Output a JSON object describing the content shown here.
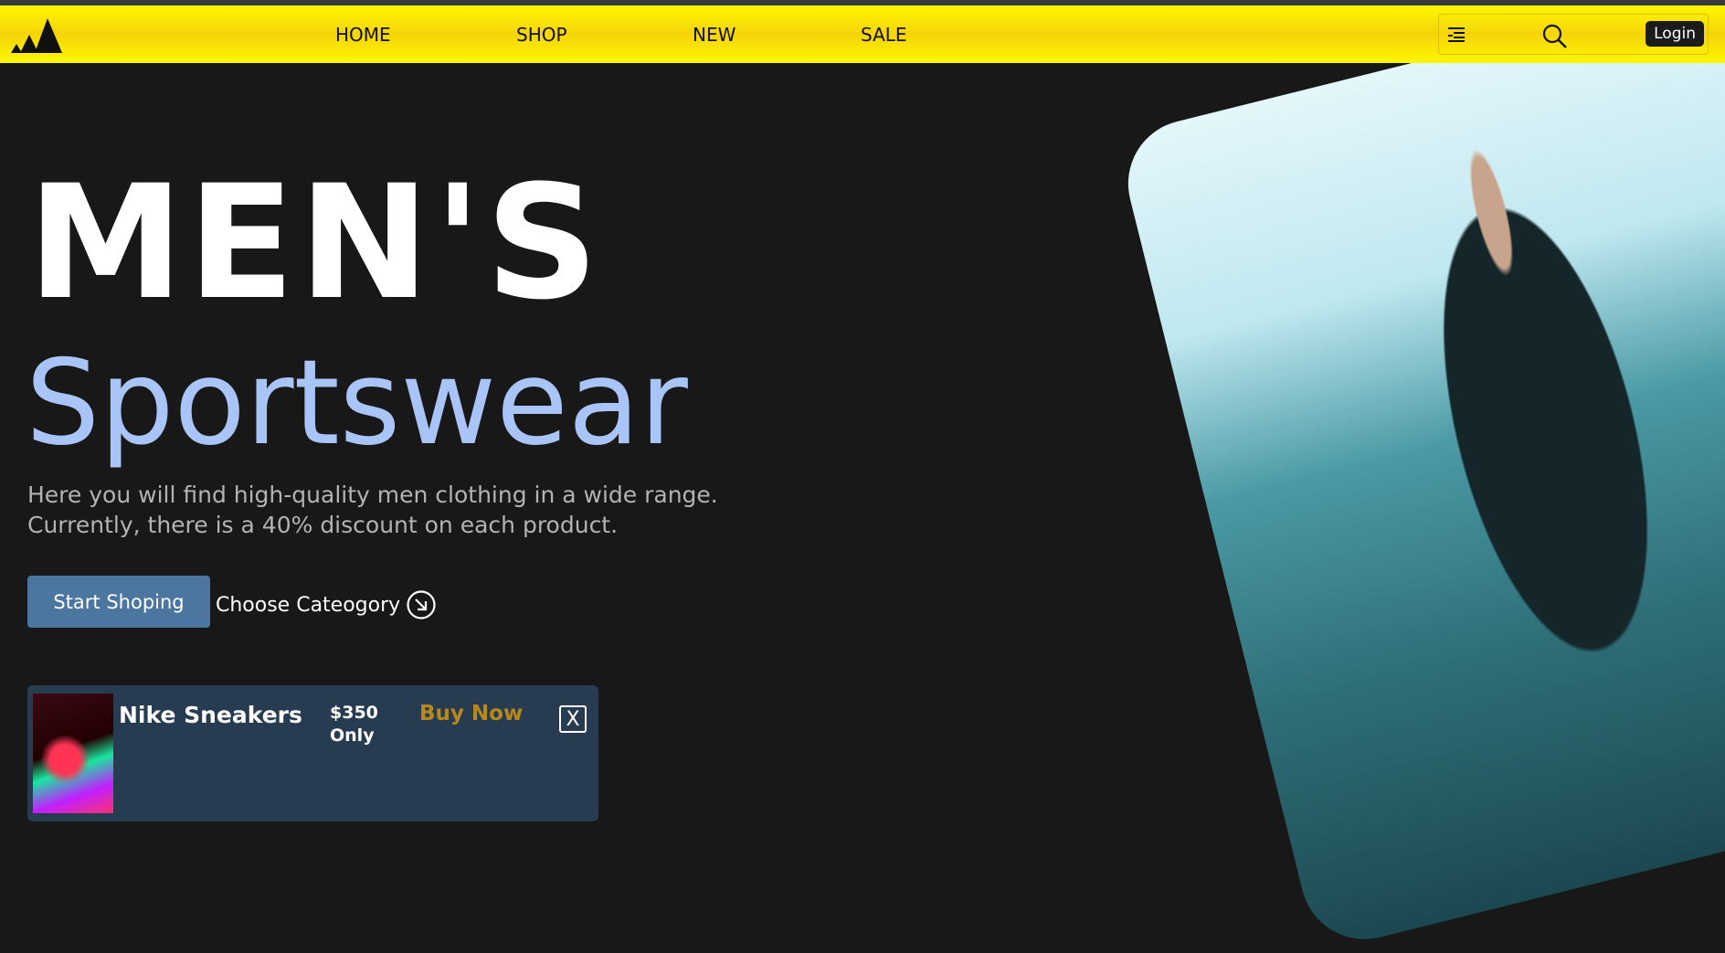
{
  "header": {
    "nav": [
      "HOME",
      "SHOP",
      "NEW",
      "SALE"
    ],
    "login_label": "Login",
    "brand_color": "#f5d40a"
  },
  "hero": {
    "title": "MEN'S",
    "subtitle": "Sportswear",
    "description_line1": "Here you will find high-quality men clothing in a wide range.",
    "description_line2": "Currently, there is a 40% discount on each product.",
    "start_button": "Start Shoping",
    "choose_link": "Choose Cateogory"
  },
  "promo": {
    "product_name": "Nike Sneakers",
    "price": "$350",
    "price_suffix": "Only",
    "buy_label": "Buy Now",
    "close_label": "X"
  }
}
